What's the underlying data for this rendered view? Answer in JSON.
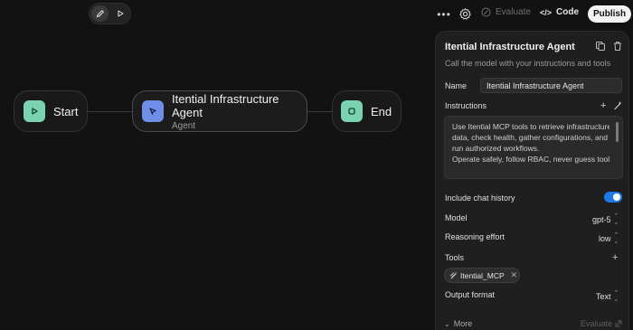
{
  "canvas": {
    "nodes": {
      "start": {
        "label": "Start",
        "icon": "play-icon",
        "color": "#7ad3b0"
      },
      "agent": {
        "label": "Itential Infrastructure Agent",
        "sublabel": "Agent",
        "icon": "cursor-icon",
        "color": "#6e8ee8"
      },
      "end": {
        "label": "End",
        "icon": "stop-icon",
        "color": "#7ad3b0"
      }
    },
    "mode_toggle": {
      "edit_icon": "pencil-icon",
      "run_icon": "play-icon"
    }
  },
  "toolbar": {
    "more_icon": "ellipsis-icon",
    "settings_icon": "gear-icon",
    "evaluate_label": "Evaluate",
    "code_label": "Code",
    "publish_label": "Publish"
  },
  "panel": {
    "title": "Itential Infrastructure Agent",
    "description": "Call the model with your instructions and tools",
    "name_label": "Name",
    "name_value": "Itential Infrastructure Agent",
    "instructions_label": "Instructions",
    "instructions_lines": [
      "Use Itential MCP tools to retrieve infrastructure",
      "data, check health, gather configurations, and",
      "run authorized workflows.",
      "Operate safely, follow RBAC, never guess tool"
    ],
    "include_chat_history_label": "Include chat history",
    "include_chat_history_enabled": true,
    "model_label": "Model",
    "model_value": "gpt-5",
    "reasoning_label": "Reasoning effort",
    "reasoning_value": "low",
    "tools_label": "Tools",
    "tools": [
      {
        "name": "Itential_MCP"
      }
    ],
    "output_format_label": "Output format",
    "output_format_value": "Text",
    "more_label": "More",
    "evaluate_label": "Evaluate",
    "accent_color": "#1f7ae8"
  }
}
